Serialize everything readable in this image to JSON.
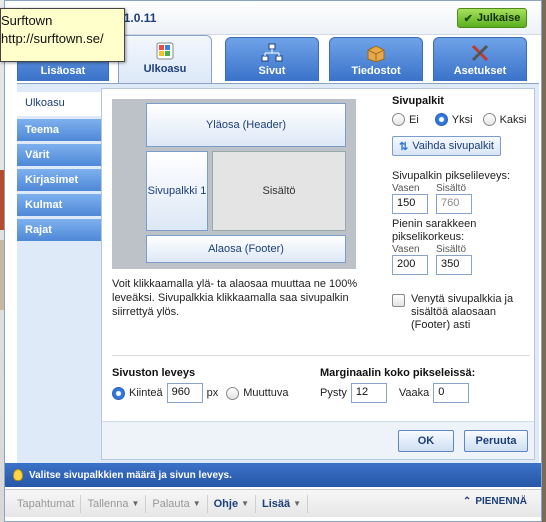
{
  "window": {
    "title": "Kotisivukone 11.0.11",
    "publish_label": "Julkaise"
  },
  "tooltip": {
    "line1": "Surftown",
    "line2": "http://surftown.se/"
  },
  "tabs": [
    {
      "label": "Lisäosat",
      "icon": "addons-icon"
    },
    {
      "label": "Ulkoasu",
      "icon": "palette-icon"
    },
    {
      "label": "Sivut",
      "icon": "sitemap-icon"
    },
    {
      "label": "Tiedostot",
      "icon": "files-box-icon"
    },
    {
      "label": "Asetukset",
      "icon": "tools-icon"
    }
  ],
  "nav": [
    {
      "label": "Ulkoasu"
    },
    {
      "label": "Teema"
    },
    {
      "label": "Värit"
    },
    {
      "label": "Kirjasimet"
    },
    {
      "label": "Kulmat"
    },
    {
      "label": "Rajat"
    }
  ],
  "layout": {
    "header": "Yläosa (Header)",
    "sidebar": "Sivupalkki 1",
    "content": "Sisältö",
    "footer": "Alaosa (Footer)"
  },
  "description": "Voit klikkaamalla ylä- ta alaosaa muuttaa ne 100% leveäksi. Sivupalkkia klikkaamalla saa sivupalkin siirrettyä ylös.",
  "sidebars": {
    "heading": "Sivupalkit",
    "options": [
      "Ei",
      "Yksi",
      "Kaksi"
    ],
    "selected": "Yksi",
    "switch_button": "Vaihda sivupalkit",
    "width_heading": "Sivupalkin pikselileveys:",
    "width_left_label": "Vasen",
    "width_right_label": "Sisältö",
    "width_left_value": "150",
    "width_right_value": "760",
    "min_height_heading": "Pienin sarakkeen pikselikorkeus:",
    "height_left_label": "Vasen",
    "height_right_label": "Sisältö",
    "height_left_value": "200",
    "height_right_value": "350",
    "stretch_label": "Venytä sivupalkkia ja sisältöä alaosaan (Footer) asti"
  },
  "site_width": {
    "heading": "Sivuston leveys",
    "fixed_label": "Kiinteä",
    "fixed_value": "960",
    "unit": "px",
    "fluid_label": "Muuttuva",
    "selected": "Kiinteä"
  },
  "margin": {
    "heading": "Marginaalin koko pikseleissä:",
    "vertical_label": "Pysty",
    "vertical_value": "12",
    "horizontal_label": "Vaaka",
    "horizontal_value": "0"
  },
  "buttons": {
    "ok": "OK",
    "cancel": "Peruuta"
  },
  "hint": "Valitse sivupalkkien määrä ja sivun leveys.",
  "bottom": {
    "items": [
      {
        "label": "Tapahtumat",
        "caret": false,
        "enabled": false
      },
      {
        "label": "Tallenna",
        "caret": true,
        "enabled": false
      },
      {
        "label": "Palauta",
        "caret": true,
        "enabled": false
      },
      {
        "label": "Ohje",
        "caret": true,
        "enabled": true
      },
      {
        "label": "Lisää",
        "caret": true,
        "enabled": true
      }
    ],
    "minimize_label": "PIENENNÄ"
  }
}
